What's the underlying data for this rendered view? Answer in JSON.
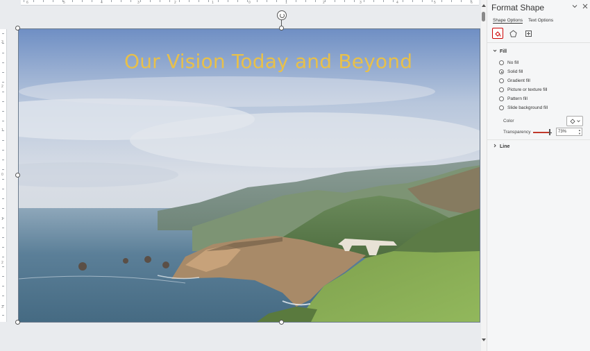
{
  "slide": {
    "title": "Our Vision Today and Beyond"
  },
  "ruler": {
    "top_numbers": [
      "6",
      "5",
      "4",
      "3",
      "2",
      "1",
      "0",
      "1",
      "2",
      "3",
      "4",
      "5",
      "6"
    ],
    "left_numbers": [
      "3",
      "2",
      "1",
      "0",
      "1",
      "2",
      "3"
    ]
  },
  "pane": {
    "title": "Format Shape",
    "collapse_icon": "chevron-down-icon",
    "close_icon": "close-icon",
    "tabs": [
      {
        "label": "Shape Options",
        "active": true
      },
      {
        "label": "Text Options",
        "active": false
      }
    ],
    "fill_section": "Fill",
    "fill_options": [
      {
        "label": "No fill",
        "checked": false
      },
      {
        "label": "Solid fill",
        "checked": true
      },
      {
        "label": "Gradient fill",
        "checked": false
      },
      {
        "label": "Picture or texture fill",
        "checked": false
      },
      {
        "label": "Pattern fill",
        "checked": false
      },
      {
        "label": "Slide background fill",
        "checked": false
      }
    ],
    "color_label": "Color",
    "transparency_label": "Transparency",
    "transparency_value": "73%",
    "transparency_fraction": 0.73,
    "line_section": "Line"
  },
  "colors": {
    "title_text": "#e8c04a",
    "accent": "#c00000"
  }
}
